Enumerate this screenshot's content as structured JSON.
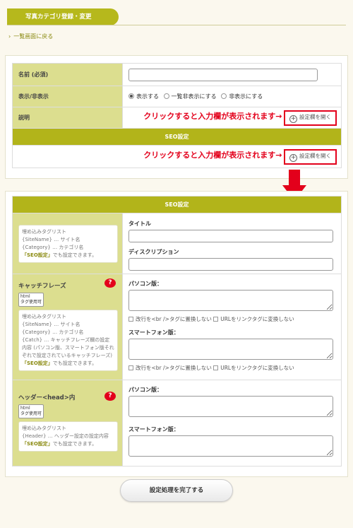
{
  "header": {
    "title": "写真カテゴリ登録・変更",
    "back_link": "一覧画面に戻る",
    "back_chevron": "›"
  },
  "basic": {
    "name_label": "名前 (必須)",
    "visibility_label": "表示/非表示",
    "visibility_options": [
      "表示する",
      "一覧非表示にする",
      "非表示にする"
    ],
    "visibility_selected": "表示する",
    "description_label": "説明",
    "annotation": "クリックすると入力欄が表示されます→",
    "open_button": "設定欄を開く",
    "seo_title": "SEO設定",
    "plus_glyph": "+"
  },
  "seo": {
    "bar_title": "SEO設定",
    "embed1": {
      "title": "埋め込みタグリスト",
      "lines": [
        "{SiteName} … サイト名",
        "{Category} … カテゴリ名"
      ],
      "note_b": "「SEO設定」",
      "note_t": "でも設定できます。"
    },
    "title_label": "タイトル",
    "desc_label": "ディスクリプション",
    "catch": {
      "label": "キャッチフレーズ",
      "badge_top": "html",
      "badge_bottom": "タグ使用可",
      "q": "?",
      "embed": {
        "title": "埋め込みタグリスト",
        "lines": [
          "{SiteName} … サイト名",
          "{Category} … カテゴリ名",
          "{Catch} … キャッチフレーズ欄の設定内容 (パソコン版、スマートフォン版それぞれで設定されているキャッチフレーズ)"
        ],
        "note_b": "「SEO設定」",
        "note_t": "でも設定できます。"
      },
      "pc_label": "パソコン版：",
      "sp_label": "スマートフォン版：",
      "opt1": "改行を<br />タグに置換しない",
      "opt2": "URLをリンクタグに変換しない"
    },
    "head": {
      "label": "ヘッダー<head>内",
      "badge_top": "html",
      "badge_bottom": "タグ使用可",
      "q": "?",
      "embed": {
        "title": "埋め込みタグリスト",
        "lines": [
          "{Header} … ヘッダー設定の設定内容"
        ],
        "note_b": "「SEO設定」",
        "note_t": "でも設定できます。"
      },
      "pc_label": "パソコン版：",
      "sp_label": "スマートフォン版："
    }
  },
  "submit_label": "設定処理を完了する",
  "colors": {
    "accent": "#b2b41a",
    "label_bg": "#dcde8f",
    "annotation": "#e3001b"
  }
}
